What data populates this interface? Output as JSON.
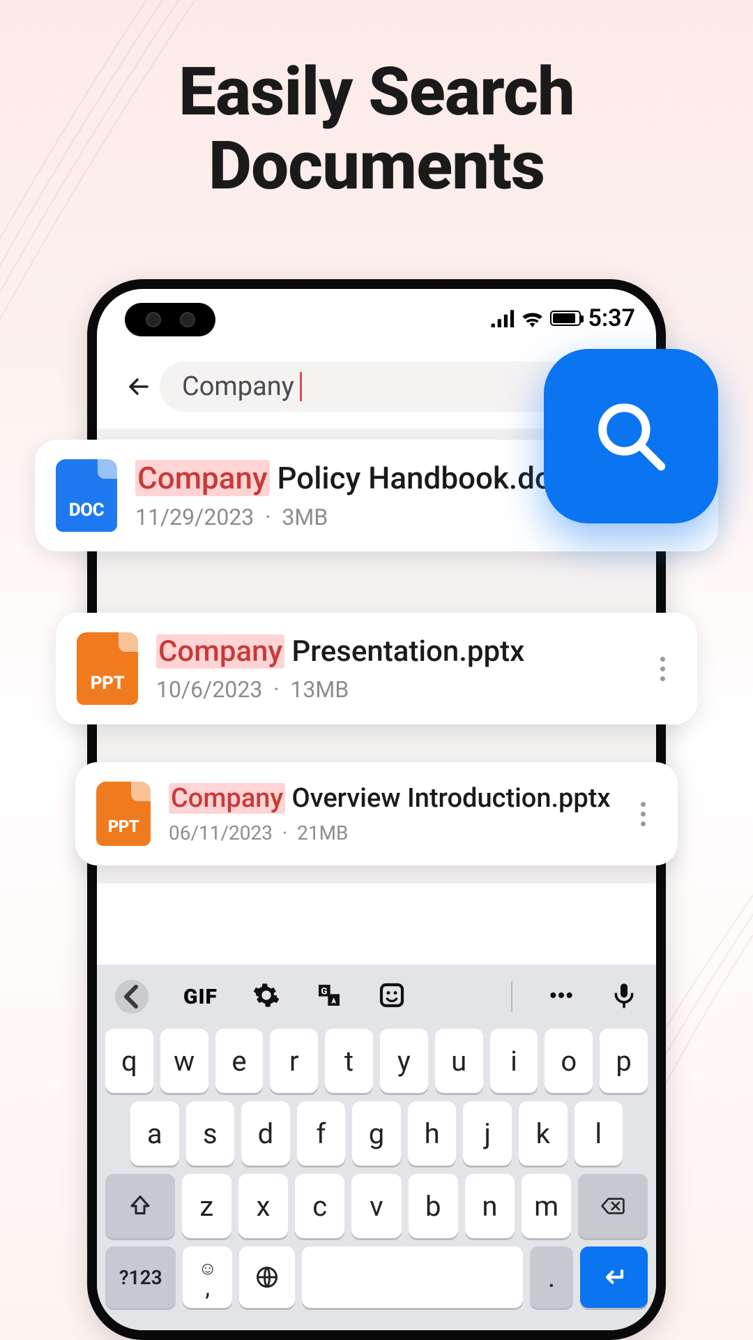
{
  "headline": {
    "line1": "Easily Search",
    "line2": "Documents"
  },
  "status": {
    "time": "5:37"
  },
  "search": {
    "query": "Company"
  },
  "icons": {
    "doc_label": "DOC",
    "ppt_label": "PPT"
  },
  "results": [
    {
      "type": "doc",
      "highlight": "Company",
      "rest": " Policy Handbook.docx",
      "date": "11/29/2023",
      "size": "3MB"
    },
    {
      "type": "ppt",
      "highlight": "Company",
      "rest": " Presentation.pptx",
      "date": "10/6/2023",
      "size": "13MB"
    },
    {
      "type": "ppt",
      "highlight": "Company",
      "rest": " Overview Introduction.pptx",
      "date": "06/11/2023",
      "size": "21MB"
    }
  ],
  "keyboard": {
    "gif": "GIF",
    "row1": [
      "q",
      "w",
      "e",
      "r",
      "t",
      "y",
      "u",
      "i",
      "o",
      "p"
    ],
    "row2": [
      "a",
      "s",
      "d",
      "f",
      "g",
      "h",
      "j",
      "k",
      "l"
    ],
    "row3": [
      "z",
      "x",
      "c",
      "v",
      "b",
      "n",
      "m"
    ],
    "num": "?123",
    "period": "."
  }
}
